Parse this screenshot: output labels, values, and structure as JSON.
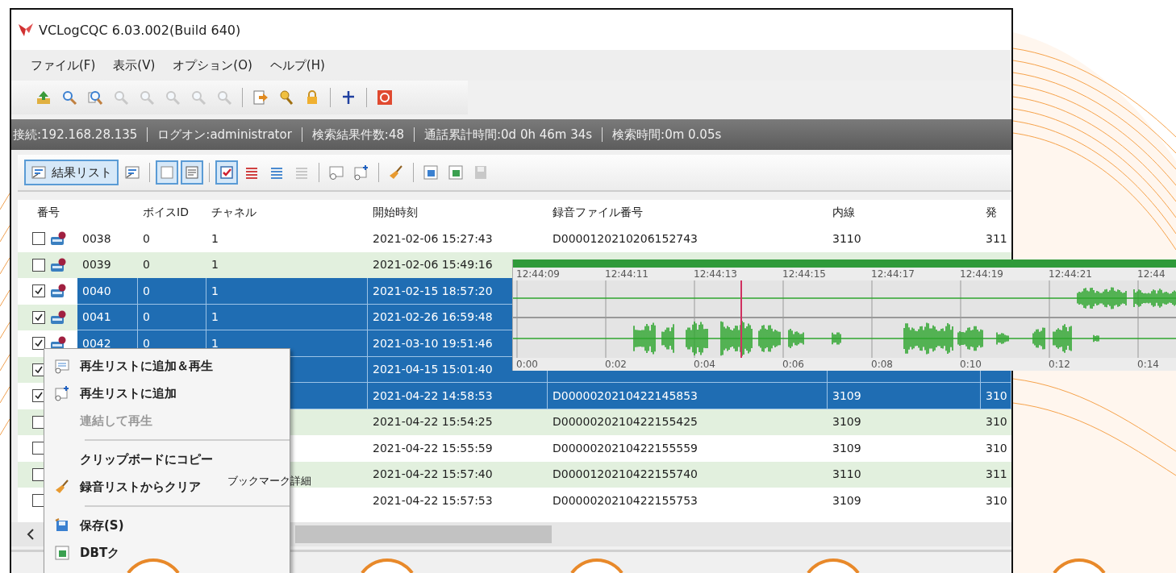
{
  "window": {
    "title": "VCLogCQC 6.03.002(Build 640)"
  },
  "menu": [
    "ファイル(F)",
    "表示(V)",
    "オプション(O)",
    "ヘルプ(H)"
  ],
  "toolbar": [
    {
      "kind": "button",
      "disabled": false
    },
    {
      "kind": "button",
      "disabled": false
    },
    {
      "kind": "button",
      "disabled": false
    },
    {
      "kind": "button",
      "disabled": true
    },
    {
      "kind": "button",
      "disabled": true
    },
    {
      "kind": "button",
      "disabled": true
    },
    {
      "kind": "button",
      "disabled": true
    },
    {
      "kind": "button",
      "disabled": true
    },
    {
      "kind": "separator"
    },
    {
      "kind": "button",
      "disabled": false
    },
    {
      "kind": "button",
      "disabled": false
    },
    {
      "kind": "button",
      "disabled": false
    },
    {
      "kind": "separator"
    },
    {
      "kind": "button",
      "disabled": false
    },
    {
      "kind": "separator"
    },
    {
      "kind": "button",
      "disabled": false
    }
  ],
  "status_bar": [
    "接続:192.168.28.135",
    "ログオン:administrator",
    "検索結果件数:48",
    "通話累計時間:0d 0h 46m 34s",
    "検索時間:0m 0.05s"
  ],
  "result_toolbar": {
    "label": "結果リスト",
    "selected": true,
    "items": [
      {
        "kind": "button",
        "selected": false,
        "disabled": false
      },
      {
        "kind": "separator"
      },
      {
        "kind": "button",
        "selected": true,
        "disabled": false
      },
      {
        "kind": "button",
        "selected": true,
        "disabled": false
      },
      {
        "kind": "separator"
      },
      {
        "kind": "button",
        "selected": true,
        "disabled": false
      },
      {
        "kind": "button",
        "selected": false,
        "disabled": false
      },
      {
        "kind": "button",
        "selected": false,
        "disabled": false
      },
      {
        "kind": "button",
        "selected": false,
        "disabled": true
      },
      {
        "kind": "separator"
      },
      {
        "kind": "button",
        "selected": false,
        "disabled": false
      },
      {
        "kind": "button",
        "selected": false,
        "disabled": false
      },
      {
        "kind": "separator"
      },
      {
        "kind": "button",
        "selected": false,
        "disabled": false
      },
      {
        "kind": "separator"
      },
      {
        "kind": "button",
        "selected": false,
        "disabled": false
      },
      {
        "kind": "button",
        "selected": false,
        "disabled": false
      },
      {
        "kind": "button",
        "selected": false,
        "disabled": true
      }
    ]
  },
  "table": {
    "columns": [
      "番号",
      "ボイスID",
      "チャネル",
      "開始時刻",
      "録音ファイル番号",
      "内線",
      "発"
    ],
    "rows": [
      {
        "checked": false,
        "selected": false,
        "number": "0038",
        "voice_id": "0",
        "channel": "1",
        "start_time": "2021-02-06 15:27:43",
        "file_number": "D0000120210206152743",
        "extension": "3110",
        "column_7": "311"
      },
      {
        "checked": false,
        "selected": false,
        "number": "0039",
        "voice_id": "0",
        "channel": "1",
        "start_time": "2021-02-06 15:49:16"
      },
      {
        "checked": true,
        "selected": true,
        "number": "0040",
        "voice_id": "0",
        "channel": "1",
        "start_time": "2021-02-15 18:57:20"
      },
      {
        "checked": true,
        "selected": true,
        "number": "0041",
        "voice_id": "0",
        "channel": "1",
        "start_time": "2021-02-26 16:59:48"
      },
      {
        "checked": true,
        "selected": true,
        "number": "0042",
        "voice_id": "0",
        "channel": "1",
        "start_time": "2021-03-10 19:51:46"
      },
      {
        "checked": true,
        "selected": true,
        "start_time": "2021-04-15 15:01:40"
      },
      {
        "checked": true,
        "selected": true,
        "start_time": "2021-04-22 14:58:53",
        "file_number": "D0000020210422145853",
        "extension": "3109",
        "column_7": "310"
      },
      {
        "checked": false,
        "selected": false,
        "start_time": "2021-04-22 15:54:25",
        "file_number": "D0000020210422155425",
        "extension": "3109",
        "column_7": "310"
      },
      {
        "checked": false,
        "selected": false,
        "start_time": "2021-04-22 15:55:59",
        "file_number": "D0000020210422155559",
        "extension": "3109",
        "column_7": "310"
      },
      {
        "checked": false,
        "selected": false,
        "start_time": "2021-04-22 15:57:40",
        "file_number": "D0000120210422155740",
        "extension": "3110",
        "column_7": "311"
      },
      {
        "checked": false,
        "selected": false,
        "start_time": "2021-04-22 15:57:53",
        "file_number": "D0000020210422155753",
        "extension": "3109",
        "column_7": "310"
      }
    ]
  },
  "waveform": {
    "time_labels": [
      "12:44:09",
      "12:44:11",
      "12:44:13",
      "12:44:15",
      "12:44:17",
      "12:44:19",
      "12:44:21",
      "12:44"
    ],
    "offset_labels": [
      "0:00",
      "0:02",
      "0:04",
      "0:06",
      "0:08",
      "0:10",
      "0:12",
      "0:14"
    ]
  },
  "context_menu": [
    {
      "kind": "item",
      "label": "再生リストに追加＆再生",
      "disabled": false
    },
    {
      "kind": "item",
      "label": "再生リストに追加",
      "disabled": false
    },
    {
      "kind": "item",
      "label": "連結して再生",
      "disabled": true
    },
    {
      "kind": "separator"
    },
    {
      "kind": "item",
      "label": "クリップボードにコピー",
      "disabled": false
    },
    {
      "kind": "item",
      "label": "録音リストからクリア",
      "disabled": false
    },
    {
      "kind": "separator"
    },
    {
      "kind": "item",
      "label": "保存(S)",
      "disabled": false
    },
    {
      "kind": "item",
      "label": "DBTク",
      "disabled": false
    }
  ],
  "tooltip": "ブックマーク詳細"
}
